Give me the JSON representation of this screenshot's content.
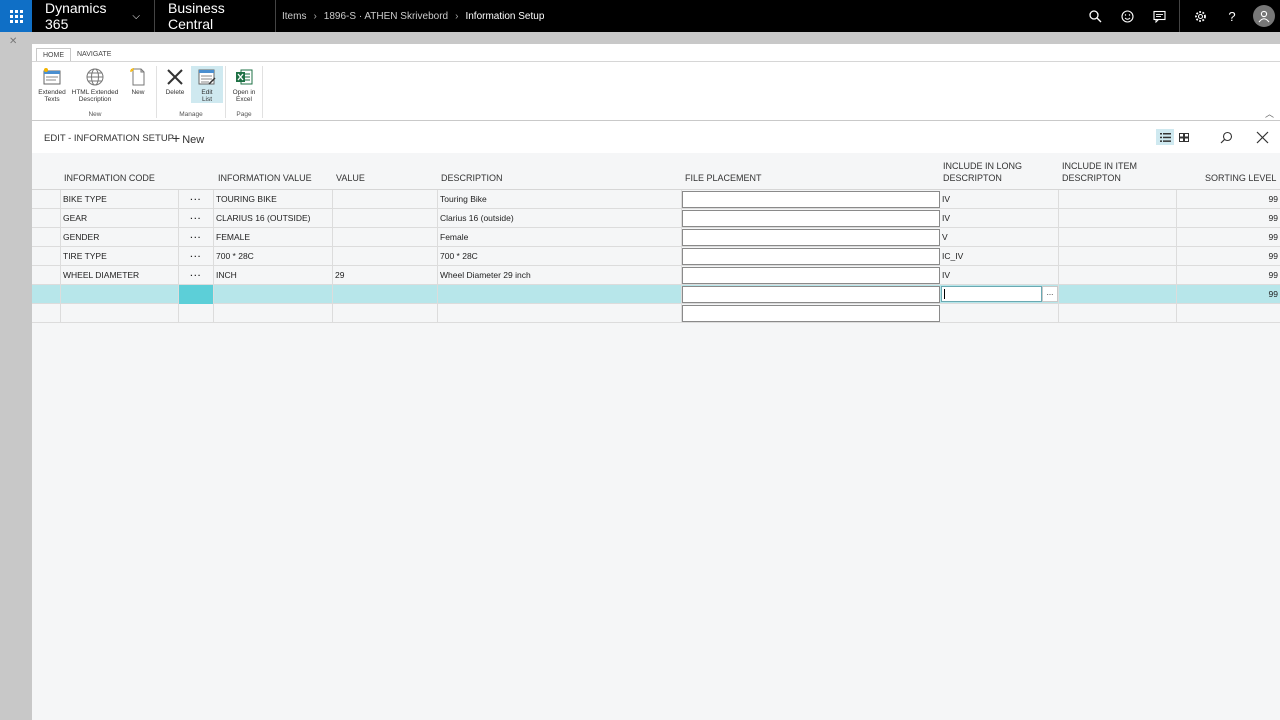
{
  "topbar": {
    "brand": "Dynamics 365",
    "product": "Business Central",
    "breadcrumbs": [
      "Items",
      "1896-S · ATHEN Skrivebord",
      "Information Setup"
    ]
  },
  "ribbon": {
    "tabs": [
      "HOME",
      "NAVIGATE"
    ],
    "groups": [
      {
        "label": "New",
        "buttons": [
          {
            "line1": "Extended",
            "line2": "Texts"
          },
          {
            "line1": "HTML Extended",
            "line2": "Description"
          },
          {
            "line1": "New",
            "line2": ""
          }
        ]
      },
      {
        "label": "Manage",
        "buttons": [
          {
            "line1": "Delete",
            "line2": ""
          },
          {
            "line1": "Edit",
            "line2": "List"
          }
        ]
      },
      {
        "label": "Page",
        "buttons": [
          {
            "line1": "Open in",
            "line2": "Excel"
          }
        ]
      }
    ]
  },
  "subheader": {
    "title": "EDIT - INFORMATION SETUP",
    "new_label": "New"
  },
  "table": {
    "headers": {
      "info_code": "INFORMATION CODE",
      "info_value": "INFORMATION VALUE",
      "value": "VALUE",
      "description": "DESCRIPTION",
      "file_placement": "FILE PLACEMENT",
      "long_desc_1": "INCLUDE IN LONG",
      "long_desc_2": "DESCRIPTON",
      "item_desc_1": "INCLUDE IN ITEM",
      "item_desc_2": "DESCRIPTON",
      "sorting": "SORTING LEVEL"
    },
    "rows": [
      {
        "code": "BIKE TYPE",
        "dots": "···",
        "info_value": "TOURING BIKE",
        "value": "",
        "description": "Touring Bike",
        "long": "IV",
        "item": "",
        "sorting": "99"
      },
      {
        "code": "GEAR",
        "dots": "···",
        "info_value": "CLARIUS 16 (OUTSIDE)",
        "value": "",
        "description": "Clarius 16 (outside)",
        "long": "IV",
        "item": "",
        "sorting": "99"
      },
      {
        "code": "GENDER",
        "dots": "···",
        "info_value": "FEMALE",
        "value": "",
        "description": "Female",
        "long": "V",
        "item": "",
        "sorting": "99"
      },
      {
        "code": "TIRE TYPE",
        "dots": "···",
        "info_value": "700 * 28C",
        "value": "",
        "description": "700 * 28C",
        "long": "IC_IV",
        "item": "",
        "sorting": "99"
      },
      {
        "code": "WHEEL DIAMETER",
        "dots": "···",
        "info_value": "INCH",
        "value": "29",
        "description": "Wheel Diameter 29 inch",
        "long": "IV",
        "item": "",
        "sorting": "99"
      }
    ],
    "new_row": {
      "sorting": "99",
      "lookup": "..."
    }
  },
  "colors": {
    "topbar": "#000000",
    "accent": "#0f6fc6",
    "selected_row": "#b7e6ea",
    "selected_marker": "#5ccfd8"
  },
  "icons": [
    "waffle-icon",
    "chevron-down-icon",
    "search-icon",
    "smiley-icon",
    "chat-icon",
    "gear-icon",
    "help-icon",
    "user-icon",
    "close-icon",
    "list-view-icon",
    "tile-view-icon"
  ]
}
